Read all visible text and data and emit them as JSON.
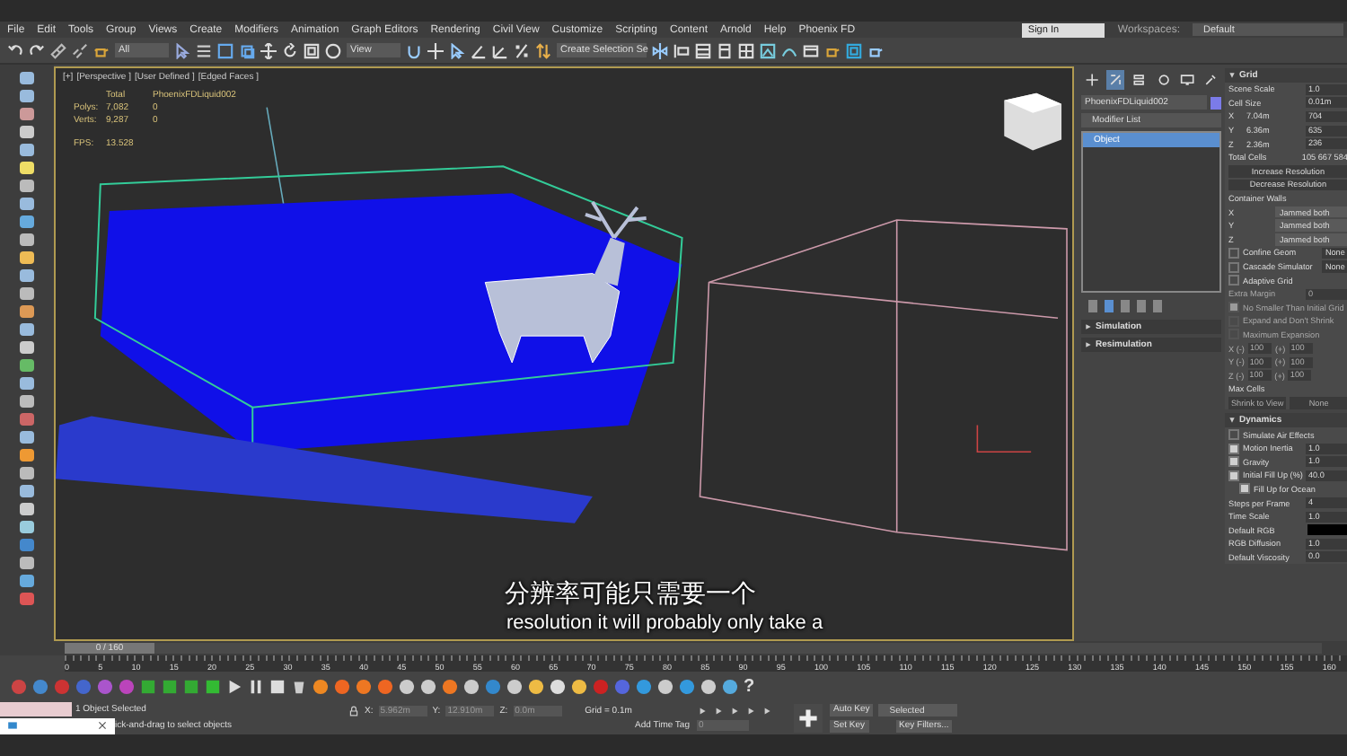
{
  "menubar": {
    "items": [
      "File",
      "Edit",
      "Tools",
      "Group",
      "Views",
      "Create",
      "Modifiers",
      "Animation",
      "Graph Editors",
      "Rendering",
      "Civil View",
      "Customize",
      "Scripting",
      "Content",
      "Arnold",
      "Help",
      "Phoenix FD"
    ],
    "sign_in": "Sign In",
    "workspaces_label": "Workspaces:",
    "workspace": "Default"
  },
  "toolbar": {
    "selection_filter": "All",
    "reference_coord": "View",
    "named_selection": "Create Selection Se"
  },
  "viewport": {
    "labels": [
      "[+]",
      "[Perspective ]",
      "[User Defined ]",
      "[Edged Faces ]"
    ],
    "stats": {
      "header": [
        "Total",
        "PhoenixFDLiquid002"
      ],
      "rows": [
        {
          "label": "Polys:",
          "total": "7,082",
          "object": "0"
        },
        {
          "label": "Verts:",
          "total": "9,287",
          "object": "0"
        }
      ],
      "fps_label": "FPS:",
      "fps": "13.528"
    },
    "subtitle_zh": "分辨率可能只需要一个",
    "subtitle_en": "resolution it will probably only take a"
  },
  "command_panel": {
    "tabs": [
      {
        "kind": "create",
        "selected": false
      },
      {
        "kind": "modify",
        "selected": true
      },
      {
        "kind": "hierarchy",
        "selected": false
      },
      {
        "kind": "motion",
        "selected": false
      },
      {
        "kind": "display",
        "selected": false
      },
      {
        "kind": "utilities",
        "selected": false
      }
    ],
    "object_name": "PhoenixFDLiquid002",
    "modifier_list": "Modifier List",
    "stack": [
      {
        "label": "Object",
        "selected": true
      }
    ],
    "stack_tools": [
      {
        "selected": false
      },
      {
        "selected": true
      },
      {
        "selected": false
      },
      {
        "selected": false
      },
      {
        "selected": false
      }
    ],
    "rollouts": [
      {
        "label": "Simulation",
        "expanded": false
      },
      {
        "label": "Resimulation",
        "expanded": false
      }
    ],
    "sections": [
      {
        "title": "Grid",
        "expanded": true,
        "rows": [
          {
            "kind": "spinner",
            "label": "Scene Scale",
            "value": "1.0"
          },
          {
            "kind": "spinner",
            "label": "Cell Size",
            "value": "0.01m"
          },
          {
            "kind": "dim",
            "label": "X",
            "size": "7.04m",
            "value": "704"
          },
          {
            "kind": "dim",
            "label": "Y",
            "size": "6.36m",
            "value": "635"
          },
          {
            "kind": "dim",
            "label": "Z",
            "size": "2.36m",
            "value": "236"
          },
          {
            "kind": "info",
            "label": "Total Cells",
            "value": "105 667 584"
          },
          {
            "kind": "button",
            "label": "Increase Resolution"
          },
          {
            "kind": "button",
            "label": "Decrease Resolution"
          },
          {
            "kind": "heading",
            "label": "Container Walls"
          },
          {
            "kind": "dropdown",
            "label": "X",
            "value": "Jammed both"
          },
          {
            "kind": "dropdown",
            "label": "Y",
            "value": "Jammed both"
          },
          {
            "kind": "dropdown",
            "label": "Z",
            "value": "Jammed both"
          },
          {
            "kind": "check-button",
            "label": "Confine Geom",
            "checked": false,
            "value": "None"
          },
          {
            "kind": "check-button",
            "label": "Cascade Simulator",
            "checked": false,
            "value": "None"
          },
          {
            "kind": "check",
            "label": "Adaptive Grid",
            "checked": false,
            "disabled": false
          },
          {
            "kind": "spinner",
            "label": "Extra Margin",
            "value": "0",
            "disabled": true
          },
          {
            "kind": "check",
            "label": "No Smaller Than Initial Grid",
            "checked": true,
            "disabled": true
          },
          {
            "kind": "check",
            "label": "Expand and Don't Shrink",
            "checked": false,
            "disabled": true
          },
          {
            "kind": "check",
            "label": "Maximum Expansion",
            "checked": false,
            "disabled": true
          },
          {
            "kind": "range",
            "minus_label": "X (-)",
            "minus": "100",
            "plus_label": "(+)",
            "plus": "100"
          },
          {
            "kind": "range",
            "minus_label": "Y (-)",
            "minus": "100",
            "plus_label": "(+)",
            "plus": "100"
          },
          {
            "kind": "range",
            "minus_label": "Z (-)",
            "minus": "100",
            "plus_label": "(+)",
            "plus": "100"
          },
          {
            "kind": "heading",
            "label": "Max Cells"
          },
          {
            "kind": "buttons",
            "labels": [
              "Shrink to View",
              "None"
            ]
          }
        ]
      },
      {
        "title": "Dynamics",
        "expanded": true,
        "rows": [
          {
            "kind": "check",
            "label": "Simulate Air Effects",
            "checked": false,
            "disabled": false
          },
          {
            "kind": "check-spinner",
            "label": "Motion Inertia",
            "checked": true,
            "value": "1.0"
          },
          {
            "kind": "check-spinner",
            "label": "Gravity",
            "checked": true,
            "value": "1.0"
          },
          {
            "kind": "check-spinner",
            "label": "Initial Fill Up (%)",
            "checked": true,
            "value": "40.0"
          },
          {
            "kind": "subcheck",
            "label": "Fill Up for Ocean",
            "checked": true
          },
          {
            "kind": "spinner",
            "label": "Steps per Frame",
            "value": "4"
          },
          {
            "kind": "spinner",
            "label": "Time Scale",
            "value": "1.0"
          },
          {
            "kind": "swatch",
            "label": "Default RGB"
          },
          {
            "kind": "spinner",
            "label": "RGB Diffusion",
            "value": "1.0"
          },
          {
            "kind": "spinner",
            "label": "Default Viscosity",
            "value": "0.0"
          }
        ]
      }
    ]
  },
  "timeline": {
    "position": "0 / 160",
    "level": 0,
    "ruler": [
      "0",
      "5",
      "10",
      "15",
      "20",
      "25",
      "30",
      "35",
      "40",
      "45",
      "50",
      "55",
      "60",
      "65",
      "70",
      "75",
      "80",
      "85",
      "90",
      "95",
      "100",
      "105",
      "110",
      "115",
      "120",
      "125",
      "130",
      "135",
      "140",
      "145",
      "150",
      "155",
      "160"
    ],
    "help": "?"
  },
  "status": {
    "selection": "1 Object Selected",
    "prompt": "ick-and-drag to select objects",
    "x_label": "X:",
    "x": "5.962m",
    "y_label": "Y:",
    "y": "12.910m",
    "z_label": "Z:",
    "z": "0.0m",
    "grid": "Grid = 0.1m",
    "time_tag": "Add Time Tag",
    "frame": "0",
    "auto_key": "Auto Key",
    "key_mode": "Selected",
    "set_key": "Set Key",
    "key_filters": "Key Filters..."
  }
}
